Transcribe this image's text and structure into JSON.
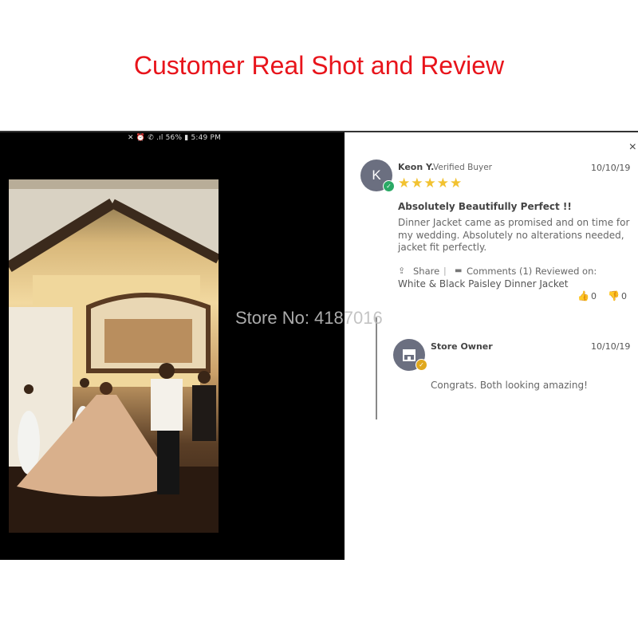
{
  "banner": {
    "title": "Customer Real Shot and Review"
  },
  "photo_panel": {
    "status_bar": "✕ ⏰ ✆ .ıl 56% ▮ 5:49 PM"
  },
  "watermark": "Store No: 4187016",
  "review": {
    "avatar_initial": "K",
    "reviewer_name": "Keon Y.",
    "reviewer_badge": "Verified Buyer",
    "date": "10/10/19",
    "rating": 5,
    "stars": "★★★★★",
    "title": "Absolutely Beautifully Perfect !!",
    "body_lines": [
      "Dinner Jacket came as promised and on time for",
      "my wedding. Absolutely no alterations needed,",
      "jacket fit perfectly."
    ],
    "share_label": "Share",
    "separator": "|",
    "comments_label": "Comments (1)",
    "reviewed_on_label": "Reviewed on:",
    "product_name": "White & Black Paisley Dinner Jacket",
    "upvotes": "0",
    "downvotes": "0",
    "star_color": "#f2c230",
    "verified_color": "#2aa965"
  },
  "reply": {
    "author": "Store Owner",
    "date": "10/10/19",
    "text": "Congrats. Both looking amazing!",
    "badge_color": "#e0a81e"
  },
  "close_label": "×"
}
